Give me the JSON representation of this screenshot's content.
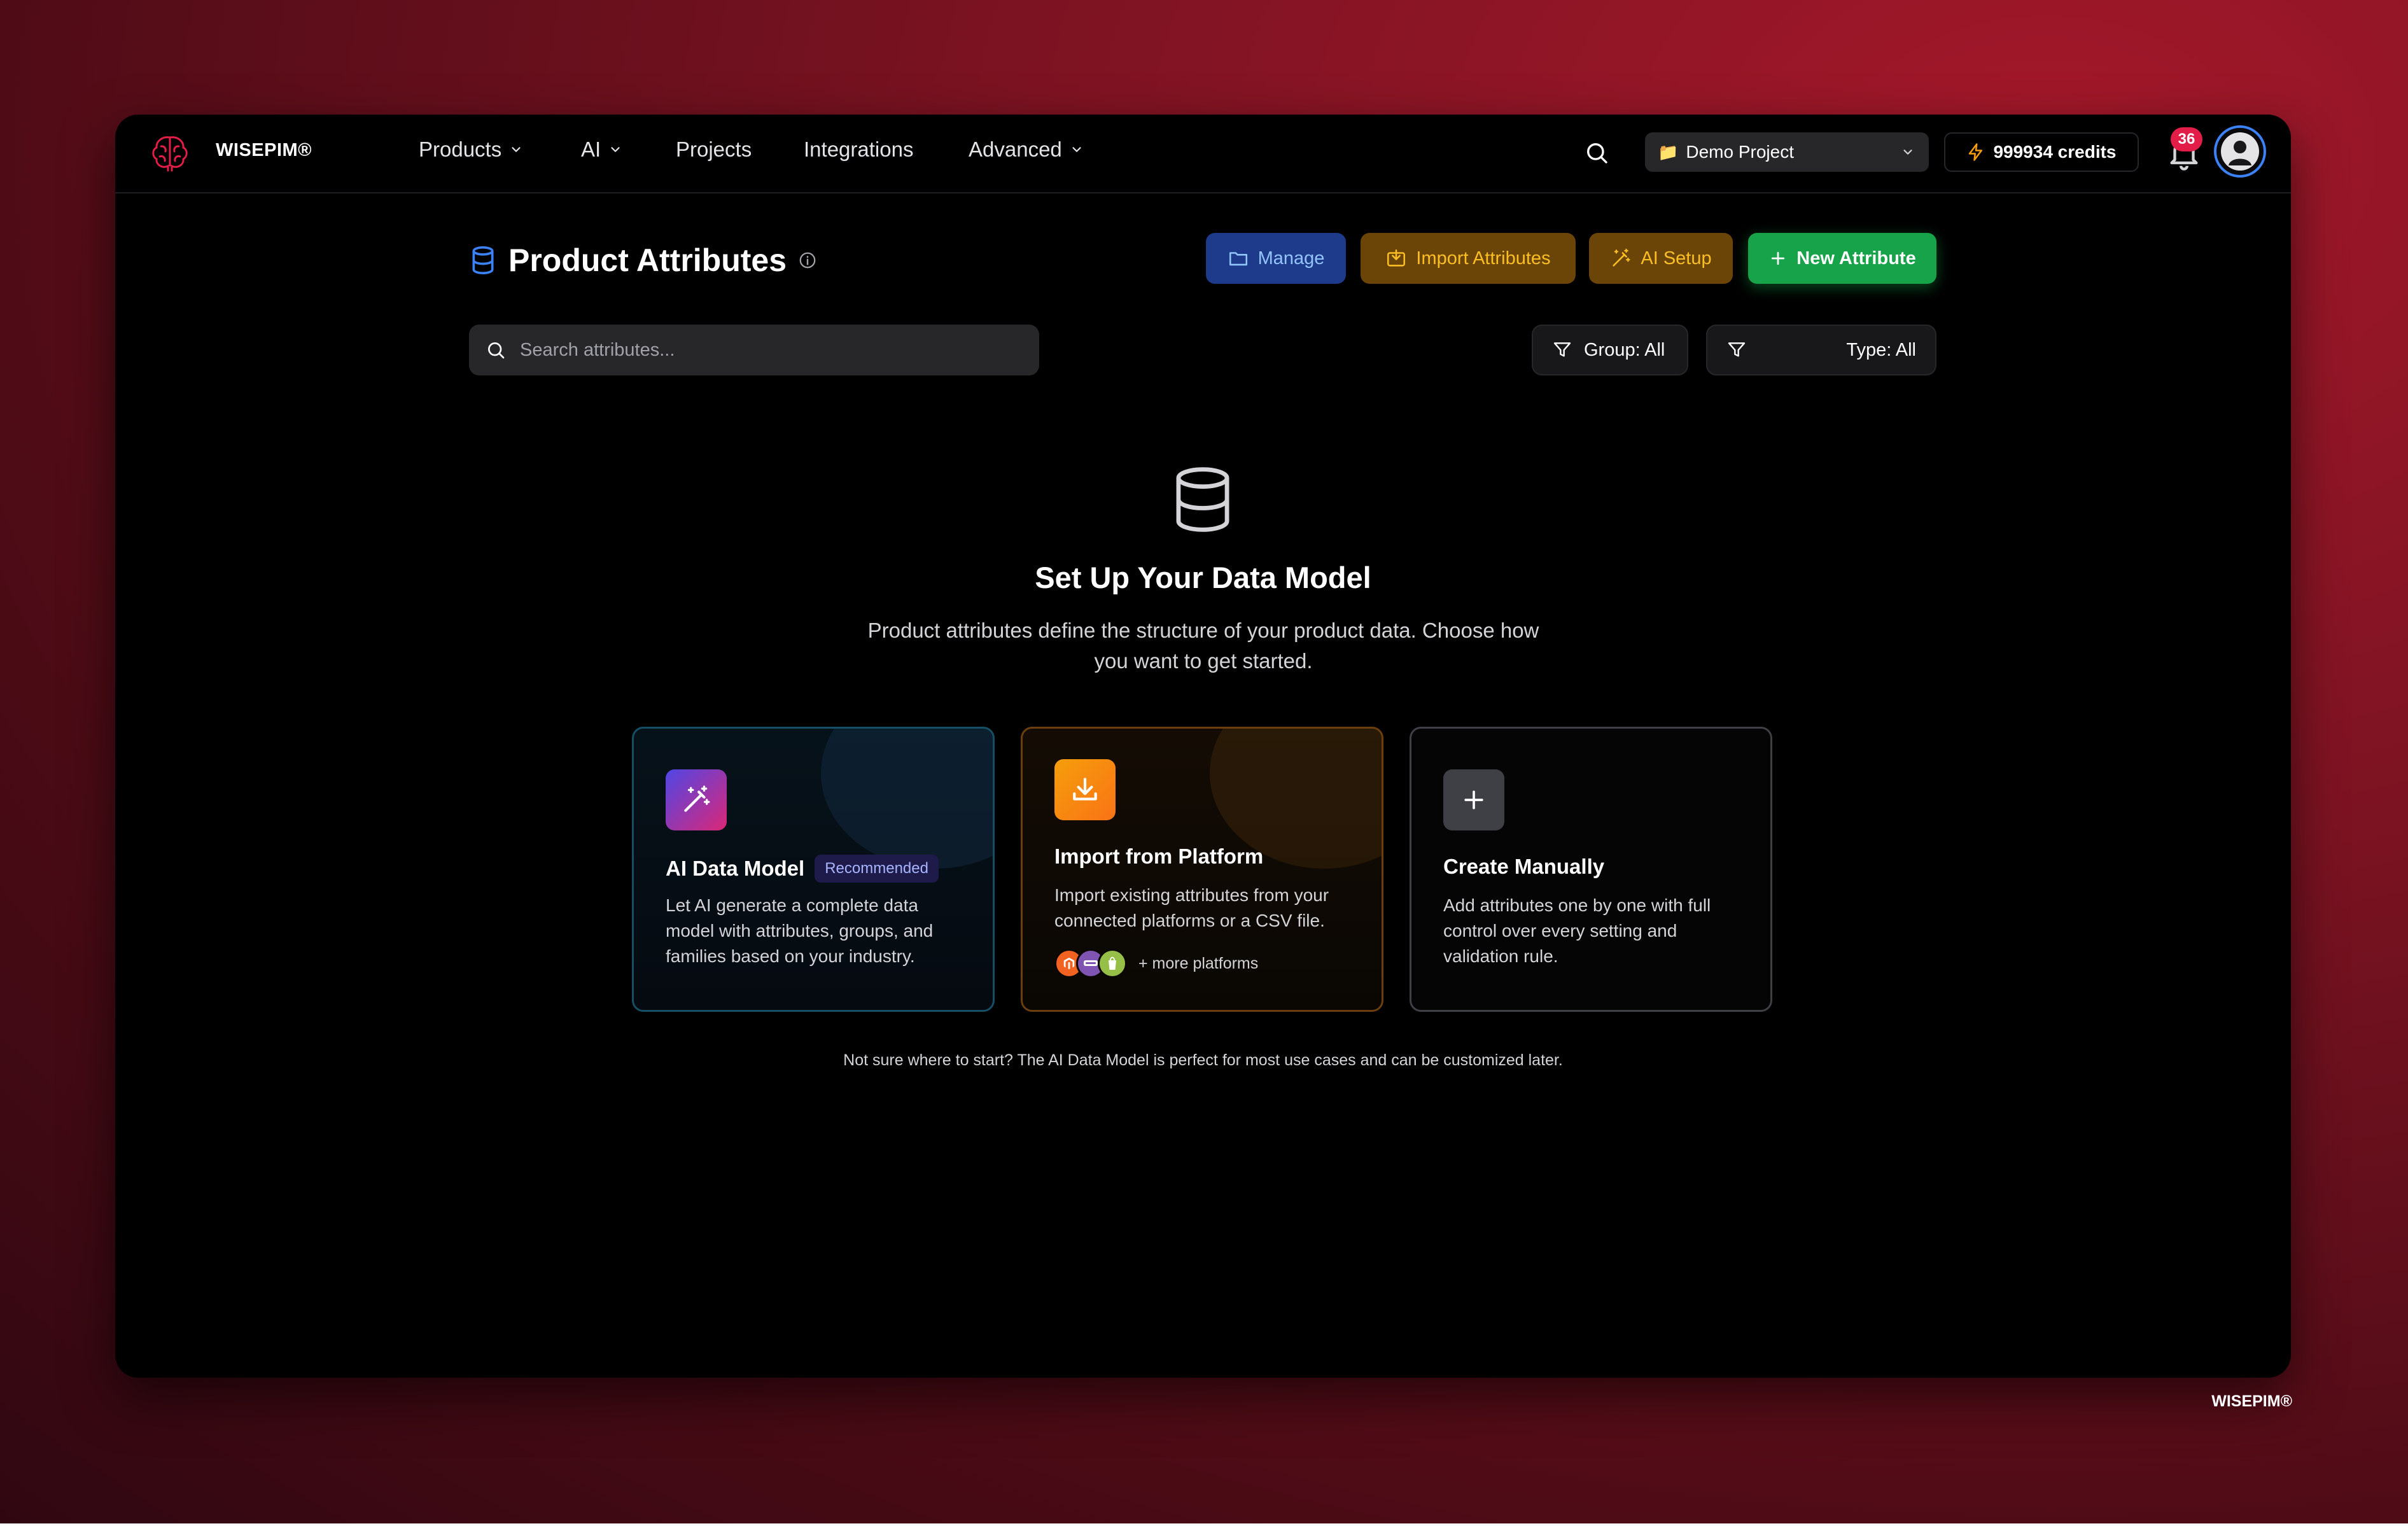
{
  "brand": {
    "name": "WISEPIM®"
  },
  "nav": {
    "items": [
      {
        "label": "Products",
        "has_dropdown": true
      },
      {
        "label": "AI",
        "has_dropdown": true
      },
      {
        "label": "Projects",
        "has_dropdown": false
      },
      {
        "label": "Integrations",
        "has_dropdown": false
      },
      {
        "label": "Advanced",
        "has_dropdown": true
      }
    ]
  },
  "header": {
    "project_select": {
      "value": "Demo Project",
      "icon": "folder-icon"
    },
    "credits_label": "999934 credits",
    "notifications_count": "36"
  },
  "page": {
    "title": "Product Attributes",
    "actions": {
      "manage": "Manage",
      "import": "Import Attributes",
      "ai_setup": "AI Setup",
      "new": "New Attribute"
    },
    "search_placeholder": "Search attributes...",
    "filters": {
      "group": "Group: All",
      "type": "Type: All"
    }
  },
  "empty_state": {
    "title": "Set Up Your Data Model",
    "description": "Product attributes define the structure of your product data. Choose how you want to get started.",
    "cards": [
      {
        "title": "AI Data Model",
        "badge": "Recommended",
        "description": "Let AI generate a complete data model with attributes, groups, and families based on your industry."
      },
      {
        "title": "Import from Platform",
        "description": "Import existing attributes from your connected platforms or a CSV file.",
        "platforms_more": "+ more platforms"
      },
      {
        "title": "Create Manually",
        "description": "Add attributes one by one with full control over every setting and validation rule."
      }
    ],
    "hint": "Not sure where to start? The AI Data Model is perfect for most use cases and can be customized later."
  },
  "colors": {
    "accent_blue": "#3b82f6",
    "accent_amber": "#fbbf24",
    "accent_green": "#16a34a",
    "badge_red": "#e11d48"
  }
}
